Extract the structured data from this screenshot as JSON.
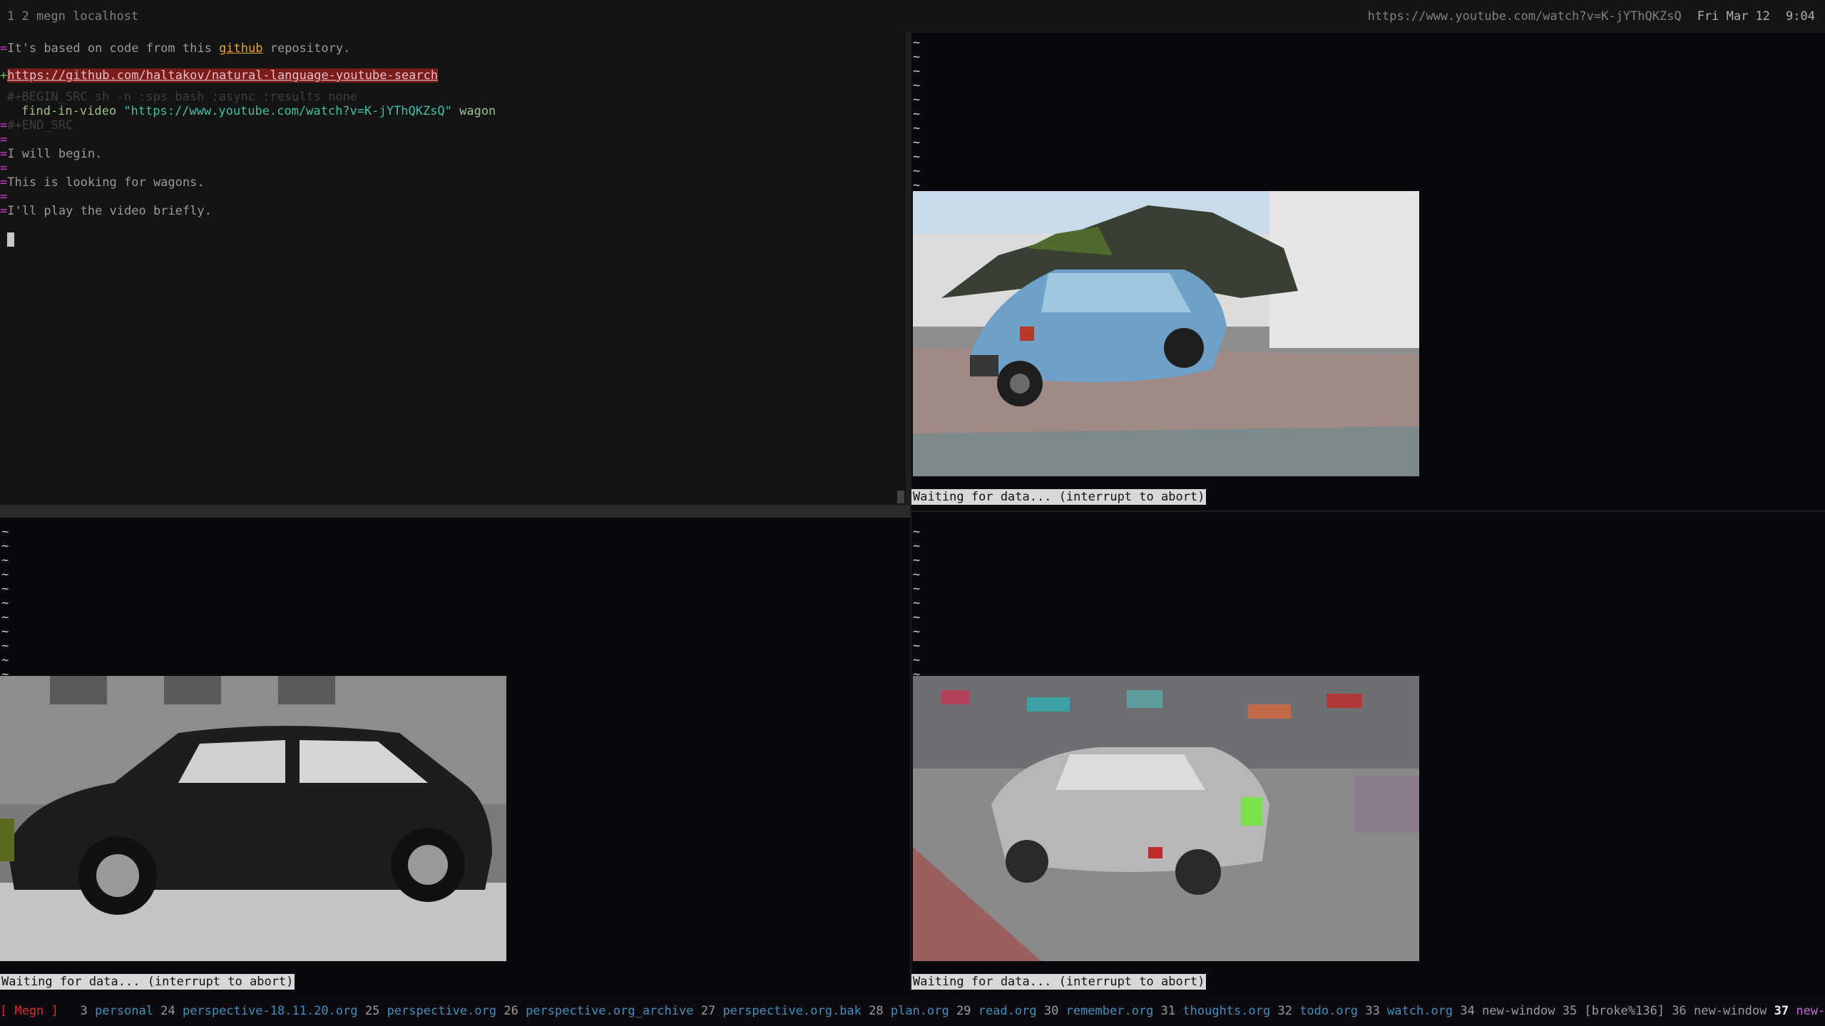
{
  "topbar": {
    "left": "1 2 megn localhost",
    "url": "https://www.youtube.com/watch?v=K-jYThQKZsQ",
    "date": "Fri Mar 12",
    "time": "9:04"
  },
  "editor": {
    "line1_gutter": "=",
    "line1_pre": "It's based on code from this ",
    "line1_link": "github",
    "line1_post": " repository.",
    "line2_gutter": "+",
    "line2_link": "https://github.com/haltakov/natural-language-youtube-search",
    "src_begin": "#+BEGIN_SRC sh -n :sps bash :async :results none",
    "cmd": "find-in-video ",
    "cmd_str": "\"https://www.youtube.com/watch?v=K-jYThQKZsQ\"",
    "cmd_arg": " wagon",
    "src_end": "#+END_SRC",
    "line_a": "I will begin.",
    "line_b": "This is looking for wagons.",
    "line_c": "I'll play the video briefly.",
    "gutter_eq": "="
  },
  "panes": {
    "tilde": "~",
    "waiting": "Waiting for data... (interrupt to abort)"
  },
  "bottombar": {
    "session": "[ Megn ]",
    "windows": [
      {
        "num": "3",
        "name": "personal",
        "style": "win"
      },
      {
        "num": "24",
        "name": "perspective-18.11.20.org",
        "style": "win"
      },
      {
        "num": "25",
        "name": "perspective.org",
        "style": "win"
      },
      {
        "num": "26",
        "name": "perspective.org_archive",
        "style": "win"
      },
      {
        "num": "27",
        "name": "perspective.org.bak",
        "style": "win"
      },
      {
        "num": "28",
        "name": "plan.org",
        "style": "win"
      },
      {
        "num": "29",
        "name": "read.org",
        "style": "win"
      },
      {
        "num": "30",
        "name": "remember.org",
        "style": "win"
      },
      {
        "num": "31",
        "name": "thoughts.org",
        "style": "win"
      },
      {
        "num": "32",
        "name": "todo.org",
        "style": "win"
      },
      {
        "num": "33",
        "name": "watch.org",
        "style": "win"
      },
      {
        "num": "34",
        "name": "new-window",
        "style": "win-plain"
      },
      {
        "num": "35",
        "name": "[broke%136]",
        "style": "win-plain"
      },
      {
        "num": "36",
        "name": "new-window",
        "style": "win-plain"
      },
      {
        "num": "37",
        "name": "new-window",
        "style": "win-cur"
      }
    ]
  },
  "icons": {
    "car_frame": "car-video-frame"
  }
}
